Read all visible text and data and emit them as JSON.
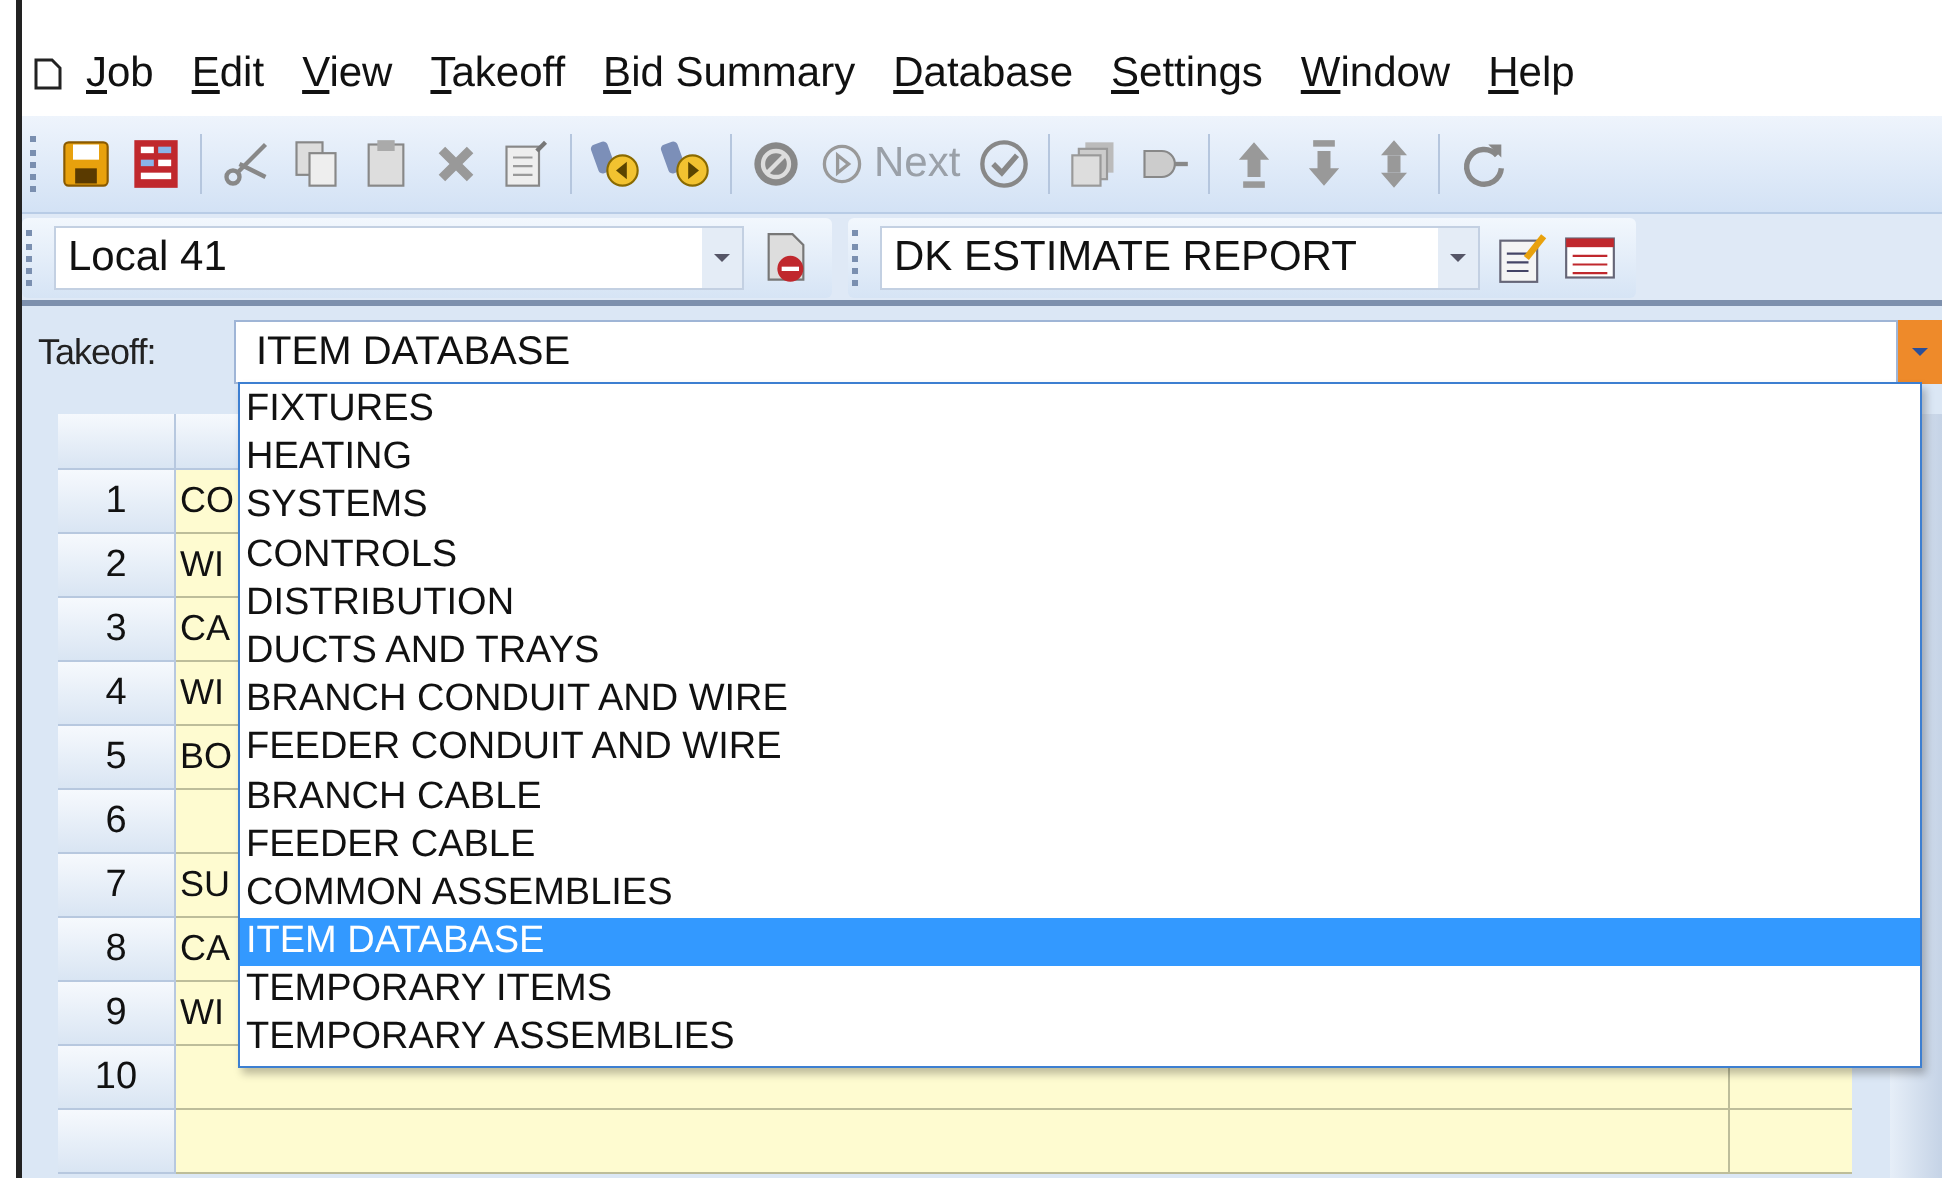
{
  "menu": [
    "Job",
    "Edit",
    "View",
    "Takeoff",
    "Bid Summary",
    "Database",
    "Settings",
    "Window",
    "Help"
  ],
  "toolbar": {
    "next_label": "Next"
  },
  "combos": [
    {
      "value": "Local 41"
    },
    {
      "value": "DK ESTIMATE REPORT"
    }
  ],
  "takeoff": {
    "label": "Takeoff:",
    "value": "ITEM DATABASE"
  },
  "dropdown": [
    {
      "label": "FIXTURES",
      "selected": false
    },
    {
      "label": "HEATING",
      "selected": false
    },
    {
      "label": "SYSTEMS",
      "selected": false
    },
    {
      "label": "CONTROLS",
      "selected": false
    },
    {
      "label": "DISTRIBUTION",
      "selected": false
    },
    {
      "label": "DUCTS AND TRAYS",
      "selected": false
    },
    {
      "label": "BRANCH CONDUIT AND WIRE",
      "selected": false
    },
    {
      "label": "FEEDER CONDUIT AND WIRE",
      "selected": false
    },
    {
      "label": "BRANCH CABLE",
      "selected": false
    },
    {
      "label": "FEEDER CABLE",
      "selected": false
    },
    {
      "label": "COMMON ASSEMBLIES",
      "selected": false
    },
    {
      "label": "ITEM DATABASE",
      "selected": true
    },
    {
      "label": "TEMPORARY ITEMS",
      "selected": false
    },
    {
      "label": "TEMPORARY ASSEMBLIES",
      "selected": false
    }
  ],
  "grid_rows": [
    {
      "number": "1",
      "cell": "CO"
    },
    {
      "number": "2",
      "cell": "WI"
    },
    {
      "number": "3",
      "cell": "CA"
    },
    {
      "number": "4",
      "cell": "WI"
    },
    {
      "number": "5",
      "cell": "BO"
    },
    {
      "number": "6",
      "cell": ""
    },
    {
      "number": "7",
      "cell": "SU"
    },
    {
      "number": "8",
      "cell": "CA"
    },
    {
      "number": "9",
      "cell": "WI"
    },
    {
      "number": "10",
      "cell": ""
    }
  ]
}
